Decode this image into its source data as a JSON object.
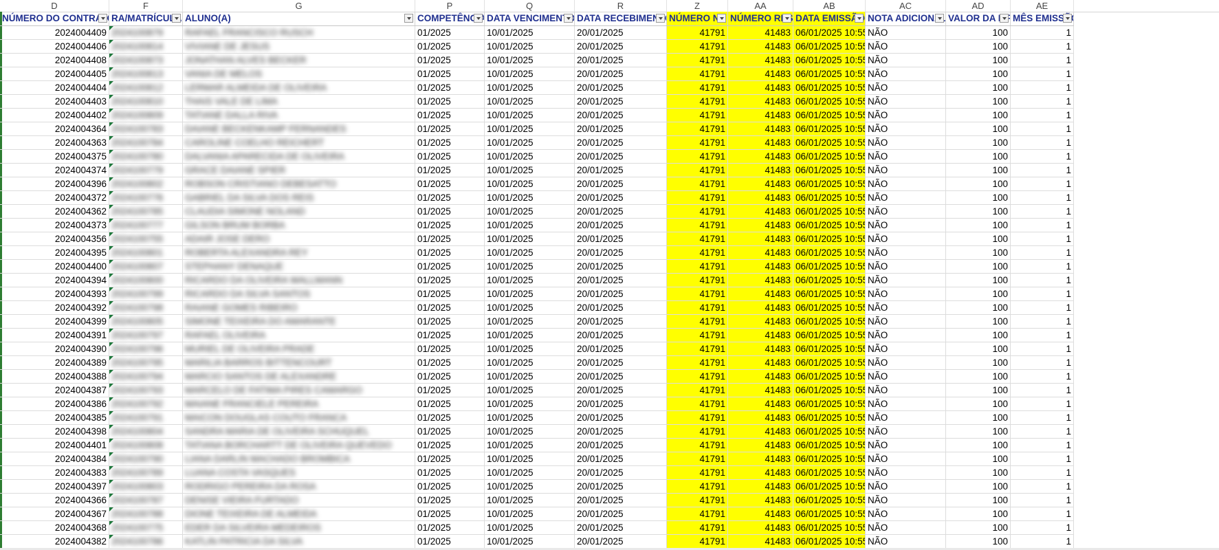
{
  "columns": [
    {
      "letter": "D",
      "header": "NÚMERO DO CONTRATO"
    },
    {
      "letter": "F",
      "header": "RA/MATRÍCULA"
    },
    {
      "letter": "G",
      "header": "ALUNO(A)"
    },
    {
      "letter": "P",
      "header": "COMPETÊNCIA"
    },
    {
      "letter": "Q",
      "header": "DATA VENCIMENTO"
    },
    {
      "letter": "R",
      "header": "DATA RECEBIMENTO"
    },
    {
      "letter": "Z",
      "header": "NÚMERO NF"
    },
    {
      "letter": "AA",
      "header": "NÚMERO RPS"
    },
    {
      "letter": "AB",
      "header": "DATA EMISSÃO"
    },
    {
      "letter": "AC",
      "header": "NOTA ADICIONAL"
    },
    {
      "letter": "AD",
      "header": "VALOR DA NF"
    },
    {
      "letter": "AE",
      "header": "MÊS EMISSÃO"
    }
  ],
  "highlight_color": "#ffff00",
  "rows": [
    {
      "contract": "2024004409",
      "ra": "2024100879",
      "name": "RAFAEL FRANCISCO RUSCH",
      "comp": "01/2025",
      "venc": "10/01/2025",
      "receb": "20/01/2025",
      "nf": "41791",
      "rps": "41483",
      "emissao": "06/01/2025 10:55",
      "nota": "NÃO",
      "valor": "100",
      "mes": "1"
    },
    {
      "contract": "2024004406",
      "ra": "2024100814",
      "name": "VIVIANE DE JESUS",
      "comp": "01/2025",
      "venc": "10/01/2025",
      "receb": "20/01/2025",
      "nf": "41791",
      "rps": "41483",
      "emissao": "06/01/2025 10:55",
      "nota": "NÃO",
      "valor": "100",
      "mes": "1"
    },
    {
      "contract": "2024004408",
      "ra": "2024100873",
      "name": "JONATHAN ALVES BECKER",
      "comp": "01/2025",
      "venc": "10/01/2025",
      "receb": "20/01/2025",
      "nf": "41791",
      "rps": "41483",
      "emissao": "06/01/2025 10:55",
      "nota": "NÃO",
      "valor": "100",
      "mes": "1"
    },
    {
      "contract": "2024004405",
      "ra": "2024100813",
      "name": "VANIA DE MELOS",
      "comp": "01/2025",
      "venc": "10/01/2025",
      "receb": "20/01/2025",
      "nf": "41791",
      "rps": "41483",
      "emissao": "06/01/2025 10:55",
      "nota": "NÃO",
      "valor": "100",
      "mes": "1"
    },
    {
      "contract": "2024004404",
      "ra": "2024100812",
      "name": "LERMAR ALMEIDA DE OLIVEIRA",
      "comp": "01/2025",
      "venc": "10/01/2025",
      "receb": "20/01/2025",
      "nf": "41791",
      "rps": "41483",
      "emissao": "06/01/2025 10:55",
      "nota": "NÃO",
      "valor": "100",
      "mes": "1"
    },
    {
      "contract": "2024004403",
      "ra": "2024100810",
      "name": "THAIS VALE DE LIMA",
      "comp": "01/2025",
      "venc": "10/01/2025",
      "receb": "20/01/2025",
      "nf": "41791",
      "rps": "41483",
      "emissao": "06/01/2025 10:55",
      "nota": "NÃO",
      "valor": "100",
      "mes": "1"
    },
    {
      "contract": "2024004402",
      "ra": "2024100809",
      "name": "TATIANE DALLA RIVA",
      "comp": "01/2025",
      "venc": "10/01/2025",
      "receb": "20/01/2025",
      "nf": "41791",
      "rps": "41483",
      "emissao": "06/01/2025 10:55",
      "nota": "NÃO",
      "valor": "100",
      "mes": "1"
    },
    {
      "contract": "2024004364",
      "ra": "2024100783",
      "name": "DAIANE BECKENKAMP FERNANDES",
      "comp": "01/2025",
      "venc": "10/01/2025",
      "receb": "20/01/2025",
      "nf": "41791",
      "rps": "41483",
      "emissao": "06/01/2025 10:55",
      "nota": "NÃO",
      "valor": "100",
      "mes": "1"
    },
    {
      "contract": "2024004363",
      "ra": "2024100784",
      "name": "CAROLINE COELHO REICHERT",
      "comp": "01/2025",
      "venc": "10/01/2025",
      "receb": "20/01/2025",
      "nf": "41791",
      "rps": "41483",
      "emissao": "06/01/2025 10:55",
      "nota": "NÃO",
      "valor": "100",
      "mes": "1"
    },
    {
      "contract": "2024004375",
      "ra": "2024100780",
      "name": "DALVANIA APARECIDA DE OLIVEIRA",
      "comp": "01/2025",
      "venc": "10/01/2025",
      "receb": "20/01/2025",
      "nf": "41791",
      "rps": "41483",
      "emissao": "06/01/2025 10:55",
      "nota": "NÃO",
      "valor": "100",
      "mes": "1"
    },
    {
      "contract": "2024004374",
      "ra": "2024100779",
      "name": "GRACE DAIANE SPIER",
      "comp": "01/2025",
      "venc": "10/01/2025",
      "receb": "20/01/2025",
      "nf": "41791",
      "rps": "41483",
      "emissao": "06/01/2025 10:55",
      "nota": "NÃO",
      "valor": "100",
      "mes": "1"
    },
    {
      "contract": "2024004396",
      "ra": "2024100802",
      "name": "ROBSON CRISTIANO DEBESATTO",
      "comp": "01/2025",
      "venc": "10/01/2025",
      "receb": "20/01/2025",
      "nf": "41791",
      "rps": "41483",
      "emissao": "06/01/2025 10:55",
      "nota": "NÃO",
      "valor": "100",
      "mes": "1"
    },
    {
      "contract": "2024004372",
      "ra": "2024100776",
      "name": "GABRIEL DA SILVA DOS REIS",
      "comp": "01/2025",
      "venc": "10/01/2025",
      "receb": "20/01/2025",
      "nf": "41791",
      "rps": "41483",
      "emissao": "06/01/2025 10:55",
      "nota": "NÃO",
      "valor": "100",
      "mes": "1"
    },
    {
      "contract": "2024004362",
      "ra": "2024100785",
      "name": "CLAUDIA SIMONE NOLAND",
      "comp": "01/2025",
      "venc": "10/01/2025",
      "receb": "20/01/2025",
      "nf": "41791",
      "rps": "41483",
      "emissao": "06/01/2025 10:55",
      "nota": "NÃO",
      "valor": "100",
      "mes": "1"
    },
    {
      "contract": "2024004373",
      "ra": "2024100777",
      "name": "GILSON BRUM BORBA",
      "comp": "01/2025",
      "venc": "10/01/2025",
      "receb": "20/01/2025",
      "nf": "41791",
      "rps": "41483",
      "emissao": "06/01/2025 10:55",
      "nota": "NÃO",
      "valor": "100",
      "mes": "1"
    },
    {
      "contract": "2024004356",
      "ra": "2024100755",
      "name": "ADAIR JOSE DERO",
      "comp": "01/2025",
      "venc": "10/01/2025",
      "receb": "20/01/2025",
      "nf": "41791",
      "rps": "41483",
      "emissao": "06/01/2025 10:55",
      "nota": "NÃO",
      "valor": "100",
      "mes": "1"
    },
    {
      "contract": "2024004395",
      "ra": "2024100801",
      "name": "ROBERTA ALEXANDRA REY",
      "comp": "01/2025",
      "venc": "10/01/2025",
      "receb": "20/01/2025",
      "nf": "41791",
      "rps": "41483",
      "emissao": "06/01/2025 10:55",
      "nota": "NÃO",
      "valor": "100",
      "mes": "1"
    },
    {
      "contract": "2024004400",
      "ra": "2024100807",
      "name": "STEPHANY DENAQUE",
      "comp": "01/2025",
      "venc": "10/01/2025",
      "receb": "20/01/2025",
      "nf": "41791",
      "rps": "41483",
      "emissao": "06/01/2025 10:55",
      "nota": "NÃO",
      "valor": "100",
      "mes": "1"
    },
    {
      "contract": "2024004394",
      "ra": "2024100800",
      "name": "RICARDO DA OLIVEIRA WALLMANN",
      "comp": "01/2025",
      "venc": "10/01/2025",
      "receb": "20/01/2025",
      "nf": "41791",
      "rps": "41483",
      "emissao": "06/01/2025 10:55",
      "nota": "NÃO",
      "valor": "100",
      "mes": "1"
    },
    {
      "contract": "2024004393",
      "ra": "2024100799",
      "name": "RICARDO DA SILVA SANTOS",
      "comp": "01/2025",
      "venc": "10/01/2025",
      "receb": "20/01/2025",
      "nf": "41791",
      "rps": "41483",
      "emissao": "06/01/2025 10:55",
      "nota": "NÃO",
      "valor": "100",
      "mes": "1"
    },
    {
      "contract": "2024004392",
      "ra": "2024100798",
      "name": "RAIANE GOMES RIBEIRO",
      "comp": "01/2025",
      "venc": "10/01/2025",
      "receb": "20/01/2025",
      "nf": "41791",
      "rps": "41483",
      "emissao": "06/01/2025 10:55",
      "nota": "NÃO",
      "valor": "100",
      "mes": "1"
    },
    {
      "contract": "2024004399",
      "ra": "2024100805",
      "name": "SIMONE TEIXEIRA DO AMARANTE",
      "comp": "01/2025",
      "venc": "10/01/2025",
      "receb": "20/01/2025",
      "nf": "41791",
      "rps": "41483",
      "emissao": "06/01/2025 10:55",
      "nota": "NÃO",
      "valor": "100",
      "mes": "1"
    },
    {
      "contract": "2024004391",
      "ra": "2024100797",
      "name": "RAFAEL OLIVEIRA",
      "comp": "01/2025",
      "venc": "10/01/2025",
      "receb": "20/01/2025",
      "nf": "41791",
      "rps": "41483",
      "emissao": "06/01/2025 10:55",
      "nota": "NÃO",
      "valor": "100",
      "mes": "1"
    },
    {
      "contract": "2024004390",
      "ra": "2024100796",
      "name": "MURIEL DE OLIVEIRA PRADE",
      "comp": "01/2025",
      "venc": "10/01/2025",
      "receb": "20/01/2025",
      "nf": "41791",
      "rps": "41483",
      "emissao": "06/01/2025 10:55",
      "nota": "NÃO",
      "valor": "100",
      "mes": "1"
    },
    {
      "contract": "2024004389",
      "ra": "2024100795",
      "name": "MARILIA BARROS BITTENCOURT",
      "comp": "01/2025",
      "venc": "10/01/2025",
      "receb": "20/01/2025",
      "nf": "41791",
      "rps": "41483",
      "emissao": "06/01/2025 10:55",
      "nota": "NÃO",
      "valor": "100",
      "mes": "1"
    },
    {
      "contract": "2024004388",
      "ra": "2024100794",
      "name": "MARCIO SANTOS DE ALEXANDRE",
      "comp": "01/2025",
      "venc": "10/01/2025",
      "receb": "20/01/2025",
      "nf": "41791",
      "rps": "41483",
      "emissao": "06/01/2025 10:55",
      "nota": "NÃO",
      "valor": "100",
      "mes": "1"
    },
    {
      "contract": "2024004387",
      "ra": "2024100793",
      "name": "MARCELO DE FATIMA PIRES CAMARGO",
      "comp": "01/2025",
      "venc": "10/01/2025",
      "receb": "20/01/2025",
      "nf": "41791",
      "rps": "41483",
      "emissao": "06/01/2025 10:55",
      "nota": "NÃO",
      "valor": "100",
      "mes": "1"
    },
    {
      "contract": "2024004386",
      "ra": "2024100792",
      "name": "MAIANE FRANCIELE PEREIRA",
      "comp": "01/2025",
      "venc": "10/01/2025",
      "receb": "20/01/2025",
      "nf": "41791",
      "rps": "41483",
      "emissao": "06/01/2025 10:55",
      "nota": "NÃO",
      "valor": "100",
      "mes": "1"
    },
    {
      "contract": "2024004385",
      "ra": "2024100791",
      "name": "MAICON DOUGLAS COUTO FRANCA",
      "comp": "01/2025",
      "venc": "10/01/2025",
      "receb": "20/01/2025",
      "nf": "41791",
      "rps": "41483",
      "emissao": "06/01/2025 10:55",
      "nota": "NÃO",
      "valor": "100",
      "mes": "1"
    },
    {
      "contract": "2024004398",
      "ra": "2024100804",
      "name": "SANDRA MARIA DE OLIVEIRA SCHUQUEL",
      "comp": "01/2025",
      "venc": "10/01/2025",
      "receb": "20/01/2025",
      "nf": "41791",
      "rps": "41483",
      "emissao": "06/01/2025 10:55",
      "nota": "NÃO",
      "valor": "100",
      "mes": "1"
    },
    {
      "contract": "2024004401",
      "ra": "2024100808",
      "name": "TATIANA BORCHARTT DE OLIVEIRA QUEVEDO",
      "comp": "01/2025",
      "venc": "10/01/2025",
      "receb": "20/01/2025",
      "nf": "41791",
      "rps": "41483",
      "emissao": "06/01/2025 10:55",
      "nota": "NÃO",
      "valor": "100",
      "mes": "1"
    },
    {
      "contract": "2024004384",
      "ra": "2024100790",
      "name": "LIANA DARLIN MACHADO BROMBICA",
      "comp": "01/2025",
      "venc": "10/01/2025",
      "receb": "20/01/2025",
      "nf": "41791",
      "rps": "41483",
      "emissao": "06/01/2025 10:55",
      "nota": "NÃO",
      "valor": "100",
      "mes": "1"
    },
    {
      "contract": "2024004383",
      "ra": "2024100789",
      "name": "LUANA COSTA VASQUES",
      "comp": "01/2025",
      "venc": "10/01/2025",
      "receb": "20/01/2025",
      "nf": "41791",
      "rps": "41483",
      "emissao": "06/01/2025 10:55",
      "nota": "NÃO",
      "valor": "100",
      "mes": "1"
    },
    {
      "contract": "2024004397",
      "ra": "2024100803",
      "name": "RODRIGO PEREIRA DA ROSA",
      "comp": "01/2025",
      "venc": "10/01/2025",
      "receb": "20/01/2025",
      "nf": "41791",
      "rps": "41483",
      "emissao": "06/01/2025 10:55",
      "nota": "NÃO",
      "valor": "100",
      "mes": "1"
    },
    {
      "contract": "2024004366",
      "ra": "2024100787",
      "name": "DENISE VIEIRA FURTADO",
      "comp": "01/2025",
      "venc": "10/01/2025",
      "receb": "20/01/2025",
      "nf": "41791",
      "rps": "41483",
      "emissao": "06/01/2025 10:55",
      "nota": "NÃO",
      "valor": "100",
      "mes": "1"
    },
    {
      "contract": "2024004367",
      "ra": "2024100788",
      "name": "DIONE TEIXEIRA DE ALMEIDA",
      "comp": "01/2025",
      "venc": "10/01/2025",
      "receb": "20/01/2025",
      "nf": "41791",
      "rps": "41483",
      "emissao": "06/01/2025 10:55",
      "nota": "NÃO",
      "valor": "100",
      "mes": "1"
    },
    {
      "contract": "2024004368",
      "ra": "2024100775",
      "name": "EDER DA SILVEIRA MEDEIROS",
      "comp": "01/2025",
      "venc": "10/01/2025",
      "receb": "20/01/2025",
      "nf": "41791",
      "rps": "41483",
      "emissao": "06/01/2025 10:55",
      "nota": "NÃO",
      "valor": "100",
      "mes": "1"
    },
    {
      "contract": "2024004382",
      "ra": "2024100786",
      "name": "KATLIN PATRICIA DA SILVA",
      "comp": "01/2025",
      "venc": "10/01/2025",
      "receb": "20/01/2025",
      "nf": "41791",
      "rps": "41483",
      "emissao": "06/01/2025 10:55",
      "nota": "NÃO",
      "valor": "100",
      "mes": "1"
    }
  ]
}
